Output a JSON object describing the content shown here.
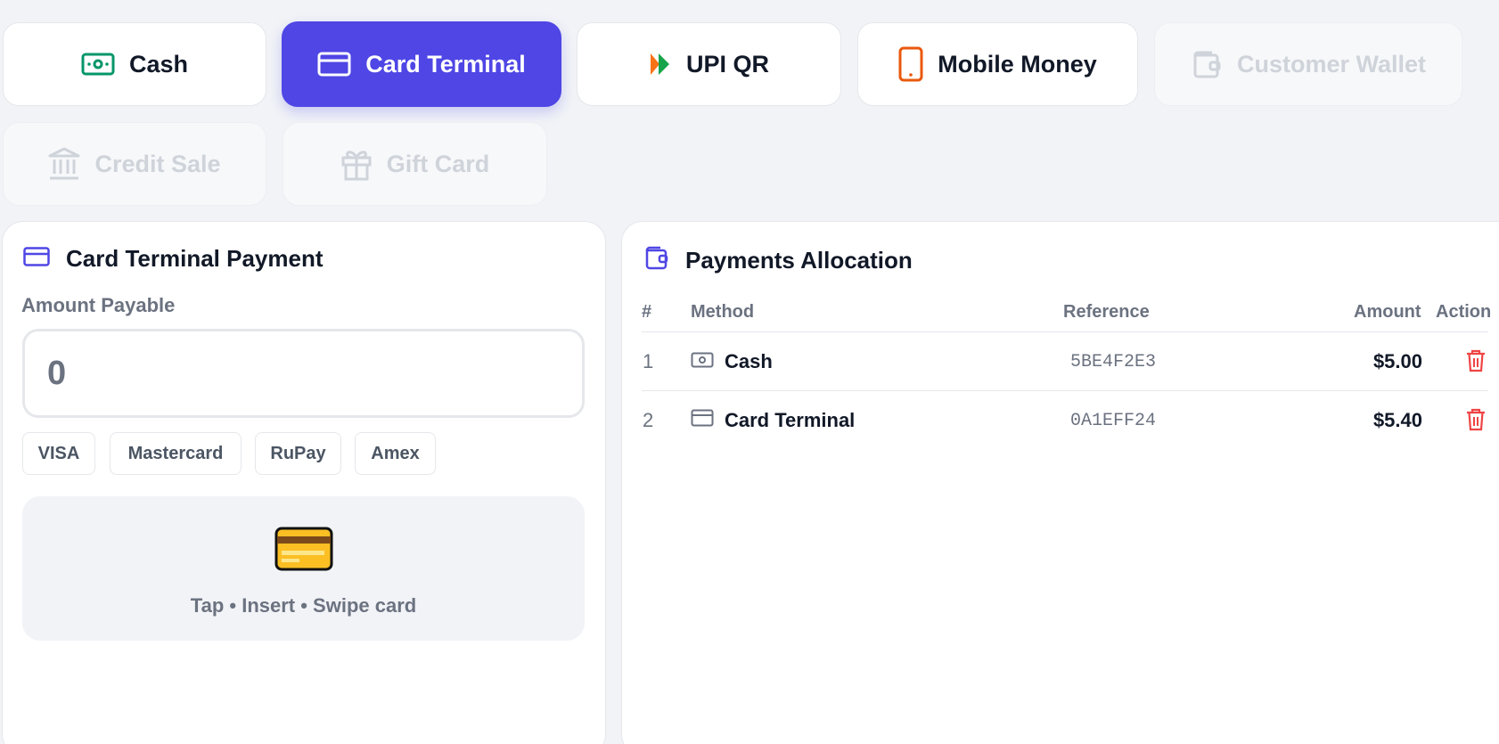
{
  "methods": {
    "cash": "Cash",
    "card_terminal": "Card Terminal",
    "upi_qr": "UPI QR",
    "mobile_money": "Mobile Money",
    "customer_wallet": "Customer Wallet",
    "credit_sale": "Credit Sale",
    "gift_card": "Gift Card"
  },
  "card_panel": {
    "title": "Card Terminal Payment",
    "amount_label": "Amount Payable",
    "amount_placeholder": "0",
    "brands": [
      "VISA",
      "Mastercard",
      "RuPay",
      "Amex"
    ],
    "card_emoji": "💳",
    "instruction": "Tap • Insert • Swipe card"
  },
  "allocation": {
    "title": "Payments Allocation",
    "headers": {
      "index": "#",
      "method": "Method",
      "reference": "Reference",
      "amount": "Amount",
      "action": "Action"
    },
    "rows": [
      {
        "index": "1",
        "method": "Cash",
        "reference": "5BE4F2E3",
        "amount": "$5.00"
      },
      {
        "index": "2",
        "method": "Card Terminal",
        "reference": "0A1EFF24",
        "amount": "$5.40"
      }
    ]
  },
  "colors": {
    "accent": "#4f46e5",
    "cash_icon": "#059669",
    "mobile_icon": "#ea580c",
    "delete_icon": "#ef4444",
    "upi_orange": "#f97316",
    "upi_green": "#16a34a"
  },
  "icons": {
    "cash": "cash-icon",
    "card": "card-icon",
    "upi": "upi-icon",
    "mobile": "mobile-icon",
    "wallet": "wallet-icon",
    "bank": "bank-icon",
    "gift": "gift-icon",
    "delete": "trash-icon"
  }
}
